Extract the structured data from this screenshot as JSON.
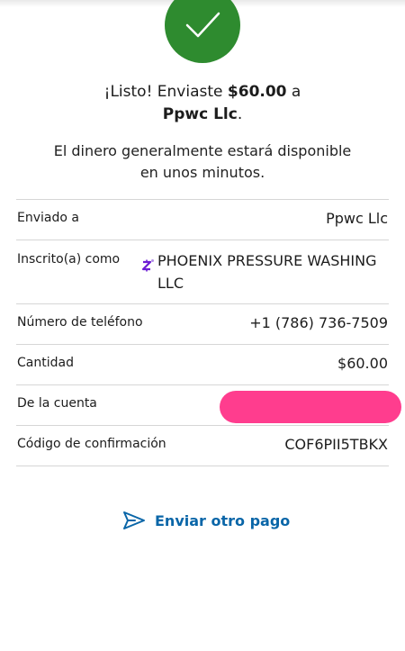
{
  "confirmation": {
    "headline_prefix": "¡Listo! Enviaste ",
    "amount": "$60.00",
    "headline_mid": " a",
    "recipient": "Ppwc Llc",
    "headline_end": ".",
    "subtext_line1": "El dinero generalmente estará disponible",
    "subtext_line2": "en unos minutos."
  },
  "details": {
    "sent_to": {
      "label": "Enviado a",
      "value": "Ppwc Llc"
    },
    "enrolled_as": {
      "label": "Inscrito(a) como",
      "value_line1": "PHOENIX PRESSURE WASHING",
      "value_line2": "LLC",
      "icon": "zelle-icon"
    },
    "phone": {
      "label": "Número de teléfono",
      "value": "+1 (786) 736-7509"
    },
    "amount": {
      "label": "Cantidad",
      "value": "$60.00"
    },
    "account": {
      "label": "De la cuenta"
    },
    "confirmation_code": {
      "label": "Código de confirmación",
      "value": "COF6PII5TBKX"
    }
  },
  "actions": {
    "send_another": "Enviar otro pago",
    "send_icon": "paper-plane-icon"
  },
  "colors": {
    "success": "#2e8b2f",
    "link": "#0a66a8",
    "zelle": "#6d1ed4",
    "redaction": "#ff3d8e"
  }
}
